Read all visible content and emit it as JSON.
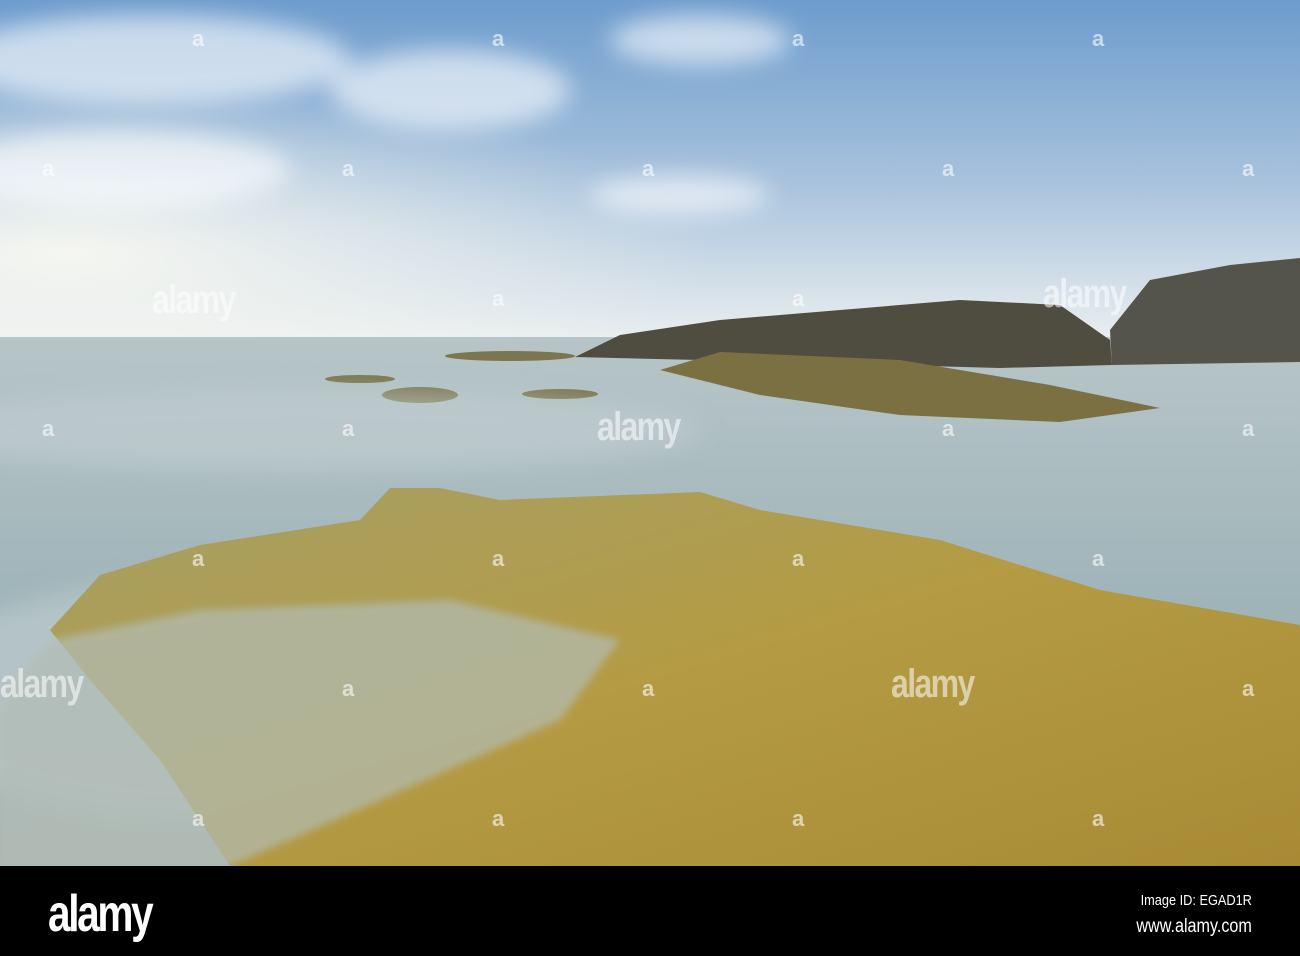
{
  "photo": {
    "subject": "long exposure seascape with moss-covered rocks",
    "colors": {
      "sky_top": "#6d9ccd",
      "sky_horizon": "#eef1ee",
      "sea": "#9db1b6",
      "rock_dark": "#4d4b3f",
      "moss": "#b39a3e"
    }
  },
  "watermark": {
    "text": "alamy",
    "mark": "a"
  },
  "footer": {
    "logo": "alamy",
    "image_id": "Image ID: EGAD1R",
    "website": "www.alamy.com"
  }
}
